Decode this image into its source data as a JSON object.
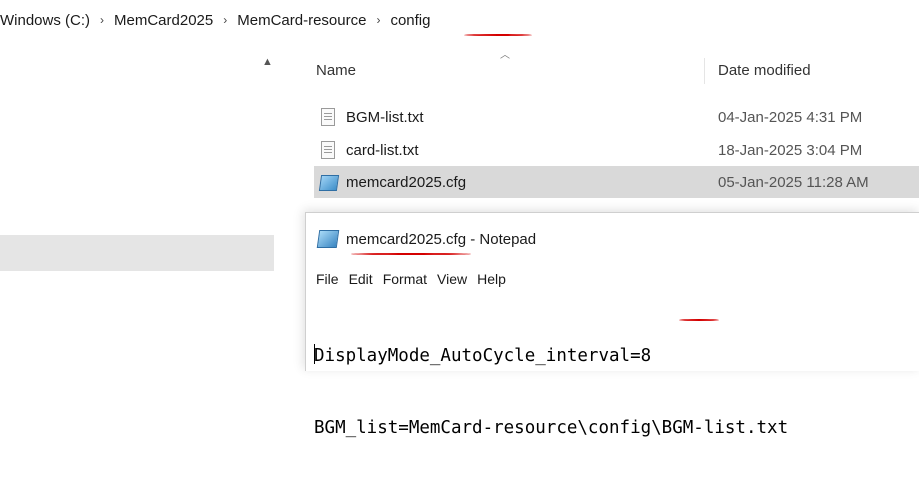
{
  "breadcrumb": {
    "items": [
      "Windows (C:)",
      "MemCard2025",
      "MemCard-resource",
      "config"
    ],
    "separator": "›"
  },
  "file_list": {
    "columns": {
      "name": "Name",
      "date": "Date modified"
    },
    "files": [
      {
        "name": "BGM-list.txt",
        "date": "04-Jan-2025 4:31 PM",
        "icon": "text-file-icon",
        "selected": false
      },
      {
        "name": "card-list.txt",
        "date": "18-Jan-2025 3:04 PM",
        "icon": "text-file-icon",
        "selected": false
      },
      {
        "name": "memcard2025.cfg",
        "date": "05-Jan-2025 11:28 AM",
        "icon": "config-file-icon",
        "selected": true
      }
    ]
  },
  "notepad": {
    "title_file": "memcard2025.cfg",
    "title_suffix": " - Notepad",
    "menu": [
      "File",
      "Edit",
      "Format",
      "View",
      "Help"
    ],
    "lines": [
      "DisplayMode_AutoCycle_interval=8",
      "BGM_list=MemCard-resource\\config\\BGM-list.txt"
    ]
  },
  "annotation_color": "#d40000"
}
